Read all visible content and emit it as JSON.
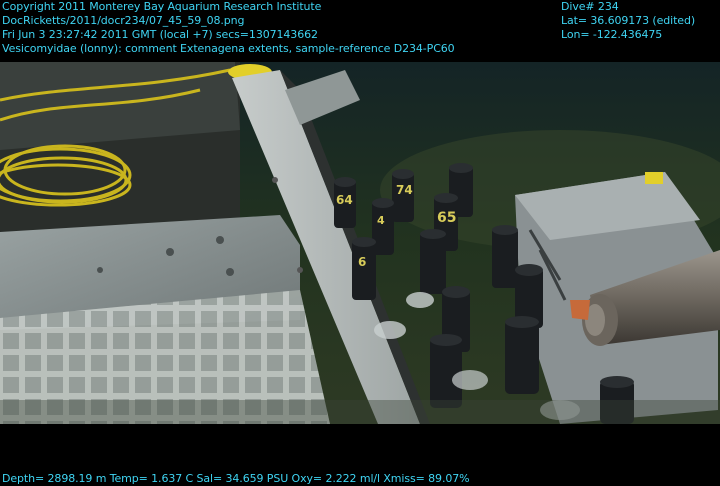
{
  "overlay": {
    "top_left": [
      "Copyright 2011 Monterey Bay Aquarium Research Institute",
      "DocRicketts/2011/docr234/07_45_59_08.png",
      "Fri Jun  3 23:27:42 2011 GMT (local +7)  secs=1307143662",
      "Vesicomyidae (lonny): comment Extenagena extents, sample-reference D234-PC60"
    ],
    "top_right": [
      "Dive# 234",
      "Lat= 36.609173 (edited)",
      "Lon= -122.436475"
    ],
    "bottom": "Depth= 2898.19 m  Temp= 1.637 C  Sal= 34.659 PSU  Oxy= 2.222 ml/l  Xmiss= 89.07%"
  },
  "scene": {
    "tube_labels": [
      "64",
      "74",
      "4",
      "65",
      "6"
    ],
    "colors": {
      "overlay_text": "#3fd4f2",
      "seafloor": "#2a3b2a",
      "tube_cap": "#1a1d20",
      "tube_label": "#d8cc5a",
      "yellow_cable": "#c9b51e"
    }
  }
}
